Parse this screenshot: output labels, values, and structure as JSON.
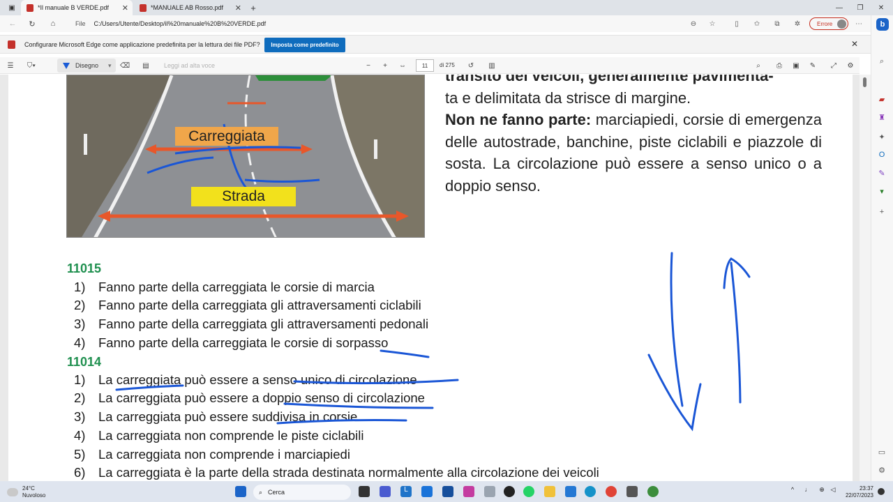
{
  "browser": {
    "tabs": [
      {
        "title": "*Il manuale B VERDE.pdf",
        "active": true
      },
      {
        "title": "*MANUALE AB Rosso.pdf",
        "active": false
      }
    ],
    "address": {
      "scheme": "File",
      "url": "C:/Users/Utente/Desktop/il%20manuale%20B%20VERDE.pdf"
    },
    "profile_button": "Errore"
  },
  "infobar": {
    "message": "Configurare Microsoft Edge come applicazione predefinita per la lettura dei file PDF?",
    "button": "Imposta come predefinito"
  },
  "pdf_toolbar": {
    "draw_label": "Disegno",
    "read_aloud": "Leggi ad alta voce",
    "page_current": "11",
    "page_total": "di 275"
  },
  "document": {
    "photo_labels": {
      "carreggiata": "Carreggiata",
      "strada": "Strada"
    },
    "definition": {
      "line0": "transito dei veicoli, generalmente pavimenta-",
      "line1": "ta e delimitata da strisce di margine.",
      "bold_lead": "Non ne fanno parte:",
      "rest": "marciapiedi, corsie di emergenza delle autostrade, banchine, piste ciclabili e piazzole di sosta. La circolazione può essere a senso unico o a doppio senso."
    },
    "questions": [
      {
        "code": "11015",
        "items": [
          {
            "n": "1)",
            "text": "Fanno parte della carreggiata le corsie di marcia"
          },
          {
            "n": "2)",
            "text": "Fanno parte della carreggiata gli attraversamenti ciclabili"
          },
          {
            "n": "3)",
            "text": "Fanno parte della carreggiata gli attraversamenti pedonali"
          },
          {
            "n": "4)",
            "text": "Fanno parte della carreggiata le corsie di sorpasso"
          }
        ]
      },
      {
        "code": "11014",
        "items": [
          {
            "n": "1)",
            "text": "La carreggiata può essere a senso unico di circolazione"
          },
          {
            "n": "2)",
            "text": "La carreggiata può essere a doppio senso di circolazione"
          },
          {
            "n": "3)",
            "text": "La carreggiata può essere suddivisa in corsie"
          },
          {
            "n": "4)",
            "text": "La carreggiata non comprende le piste ciclabili"
          },
          {
            "n": "5)",
            "text": "La carreggiata non comprende i marciapiedi"
          },
          {
            "n": "6)",
            "text": "La carreggiata è la parte della strada destinata normalmente alla circolazione dei veicoli"
          }
        ]
      }
    ]
  },
  "taskbar": {
    "weather_temp": "24°C",
    "weather_desc": "Nuvoloso",
    "search_placeholder": "Cerca",
    "time": "23:37",
    "date": "22/07/2023"
  },
  "colors": {
    "ink": "#1a56d6",
    "accent": "#0f6cbd",
    "question_code": "#1e8f4e",
    "error": "#c42b1c"
  }
}
